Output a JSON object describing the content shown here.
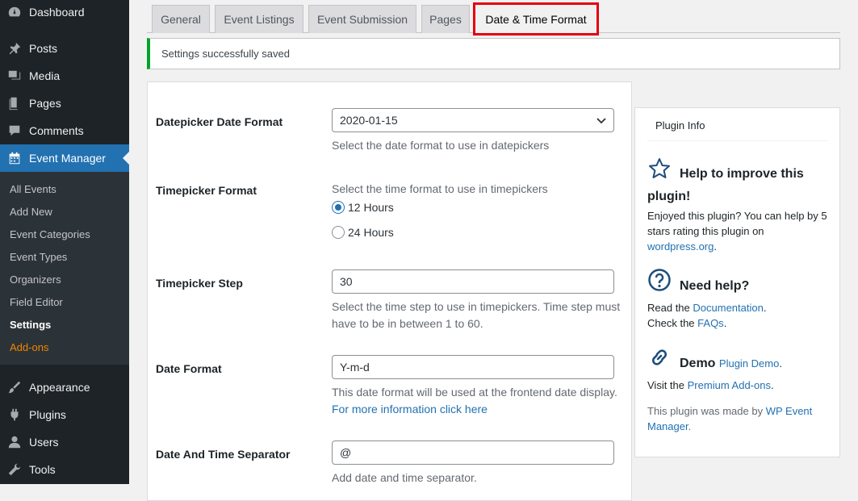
{
  "sidebar": {
    "top_items": [
      {
        "label": "Dashboard",
        "icon": "dashboard-icon"
      },
      {
        "label": "Posts",
        "icon": "pin-icon"
      },
      {
        "label": "Media",
        "icon": "media-icon"
      },
      {
        "label": "Pages",
        "icon": "pages-icon"
      },
      {
        "label": "Comments",
        "icon": "comment-icon"
      },
      {
        "label": "Event Manager",
        "icon": "calendar-icon"
      }
    ],
    "submenu": [
      "All Events",
      "Add New",
      "Event Categories",
      "Event Types",
      "Organizers",
      "Field Editor",
      "Settings",
      "Add-ons"
    ],
    "bottom_items": [
      {
        "label": "Appearance",
        "icon": "brush-icon"
      },
      {
        "label": "Plugins",
        "icon": "plugin-icon"
      },
      {
        "label": "Users",
        "icon": "user-icon"
      },
      {
        "label": "Tools",
        "icon": "wrench-icon"
      }
    ]
  },
  "tabs": [
    "General",
    "Event Listings",
    "Event Submission",
    "Pages",
    "Date & Time Format"
  ],
  "notice": "Settings successfully saved",
  "settings": {
    "datepicker": {
      "label": "Datepicker Date Format",
      "value": "2020-01-15",
      "desc": "Select the date format to use in datepickers"
    },
    "timepicker": {
      "label": "Timepicker Format",
      "desc": "Select the time format to use in timepickers",
      "options": [
        "12 Hours",
        "24 Hours"
      ],
      "selected": "12 Hours"
    },
    "step": {
      "label": "Timepicker Step",
      "value": "30",
      "desc": "Select the time step to use in timepickers. Time step must have to be in between 1 to 60."
    },
    "date_format": {
      "label": "Date Format",
      "value": "Y-m-d",
      "desc": "This date format will be used at the frontend date display.",
      "link": "For more information click here"
    },
    "separator": {
      "label": "Date And Time Separator",
      "value": "@",
      "desc": "Add date and time separator."
    }
  },
  "plugin_info": {
    "title": "Plugin Info",
    "improve_head": "Help to improve this plugin!",
    "improve_text": "Enjoyed this plugin? You can help by 5 stars rating this plugin on",
    "improve_link": "wordpress.org",
    "help_head": "Need help?",
    "help_read": "Read the",
    "help_doc_link": "Documentation",
    "help_check": "Check the",
    "help_faq_link": "FAQs",
    "demo_head": "Demo",
    "demo_link": "Plugin Demo",
    "visit_text": "Visit the",
    "addons_link": "Premium Add-ons",
    "made_by": "This plugin was made by",
    "made_by_link": "WP Event Manager"
  }
}
